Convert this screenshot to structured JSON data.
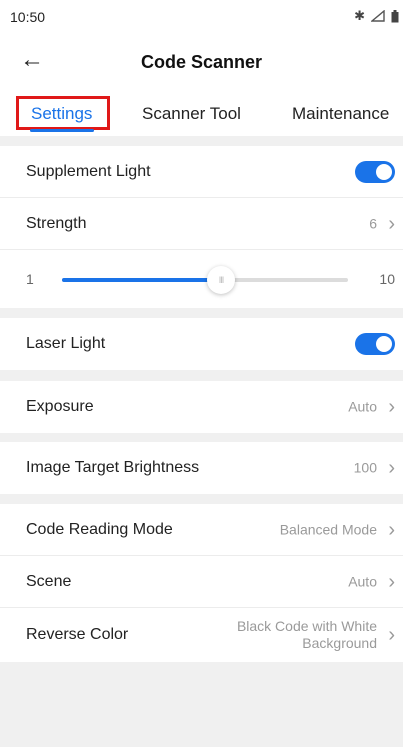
{
  "status_bar": {
    "time": "10:50",
    "icons": [
      "bluetooth-icon",
      "signal-icon",
      "battery-icon"
    ]
  },
  "header": {
    "title": "Code Scanner",
    "back_icon": "back-arrow-icon"
  },
  "tabs": [
    {
      "label": "Settings",
      "active": true
    },
    {
      "label": "Scanner Tool",
      "active": false
    },
    {
      "label": "Maintenance",
      "active": false
    }
  ],
  "supplement_light": {
    "label": "Supplement Light",
    "enabled": true
  },
  "strength": {
    "label": "Strength",
    "value": "6",
    "min": "1",
    "max": "10",
    "level": 6
  },
  "laser_light": {
    "label": "Laser Light",
    "enabled": true
  },
  "exposure": {
    "label": "Exposure",
    "value": "Auto"
  },
  "image_target_brightness": {
    "label": "Image Target Brightness",
    "value": "100"
  },
  "code_reading_mode": {
    "label": "Code Reading Mode",
    "value": "Balanced Mode"
  },
  "scene": {
    "label": "Scene",
    "value": "Auto"
  },
  "reverse_color": {
    "label": "Reverse Color",
    "value_line1": "Black Code with White",
    "value_line2": "Background"
  },
  "colors": {
    "accent": "#1a73e8",
    "highlight": "#e01818",
    "background": "#f0f0f0"
  }
}
